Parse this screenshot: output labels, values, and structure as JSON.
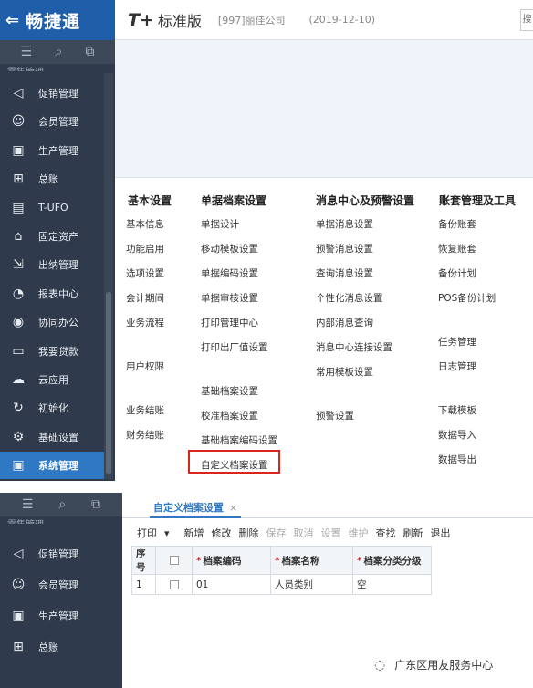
{
  "brand": {
    "back_icon": "back-arrow-icon",
    "name": "畅捷通"
  },
  "appbar": {
    "product": "T+",
    "edition": "标准版",
    "company": "[997]丽佳公司",
    "date": "(2019-12-10)",
    "search_stub": "搜"
  },
  "sidebar_top": {
    "toolbar_icons": [
      "menu-icon",
      "search-icon",
      "new-window-icon"
    ],
    "cut_label": "零售管理",
    "items": [
      {
        "label": "促销管理",
        "icon": "megaphone-icon",
        "glyph": "◁"
      },
      {
        "label": "会员管理",
        "icon": "member-icon",
        "glyph": "☺"
      },
      {
        "label": "生产管理",
        "icon": "production-icon",
        "glyph": "▣"
      },
      {
        "label": "总账",
        "icon": "ledger-icon",
        "glyph": "⊞"
      },
      {
        "label": "T-UFO",
        "icon": "ufo-icon",
        "glyph": "▤"
      },
      {
        "label": "固定资产",
        "icon": "bank-icon",
        "glyph": "⌂"
      },
      {
        "label": "出纳管理",
        "icon": "cashier-icon",
        "glyph": "⇲"
      },
      {
        "label": "报表中心",
        "icon": "report-icon",
        "glyph": "◔"
      },
      {
        "label": "协同办公",
        "icon": "collab-icon",
        "glyph": "◉"
      },
      {
        "label": "我要贷款",
        "icon": "loan-icon",
        "glyph": "▭"
      },
      {
        "label": "云应用",
        "icon": "cloud-icon",
        "glyph": "☁"
      },
      {
        "label": "初始化",
        "icon": "init-icon",
        "glyph": "↻"
      },
      {
        "label": "基础设置",
        "icon": "gear-icon",
        "glyph": "⚙"
      },
      {
        "label": "系统管理",
        "icon": "system-icon",
        "glyph": "▣"
      }
    ]
  },
  "menu": {
    "col1": {
      "header": "基本设置",
      "items": [
        "基本信息",
        "功能启用",
        "选项设置",
        "会计期间",
        "业务流程",
        "用户权限",
        "业务结账",
        "财务结账"
      ]
    },
    "col2": {
      "header": "单据档案设置",
      "items": [
        "单据设计",
        "移动模板设置",
        "单据编码设置",
        "单据审核设置",
        "打印管理中心",
        "打印出厂值设置",
        "基础档案设置",
        "校准档案设置",
        "基础档案编码设置",
        "自定义档案设置"
      ]
    },
    "col3": {
      "header": "消息中心及预警设置",
      "items": [
        "单据消息设置",
        "预警消息设置",
        "查询消息设置",
        "个性化消息设置",
        "内部消息查询",
        "消息中心连接设置",
        "常用模板设置",
        "预警设置"
      ]
    },
    "col4": {
      "header": "账套管理及工具",
      "items": [
        "备份账套",
        "恢复账套",
        "备份计划",
        "POS备份计划",
        "任务管理",
        "日志管理",
        "下载模板",
        "数据导入",
        "数据导出"
      ]
    }
  },
  "sidebar_bottom": {
    "toolbar_icons": [
      "menu-icon",
      "search-icon",
      "new-window-icon"
    ],
    "items": [
      {
        "label": "促销管理",
        "icon": "megaphone-icon",
        "glyph": "◁"
      },
      {
        "label": "会员管理",
        "icon": "member-icon",
        "glyph": "☺"
      },
      {
        "label": "生产管理",
        "icon": "production-icon",
        "glyph": "▣"
      },
      {
        "label": "总账",
        "icon": "ledger-icon",
        "glyph": "⊞"
      }
    ]
  },
  "doc_tab": {
    "label": "自定义档案设置",
    "close": "×"
  },
  "toolbar": {
    "print": "打印",
    "print_arrow": "▾",
    "new": "新增",
    "edit": "修改",
    "delete": "删除",
    "save": "保存",
    "cancel": "取消",
    "settings": "设置",
    "maintain": "维护",
    "find": "查找",
    "refresh": "刷新",
    "exit": "退出"
  },
  "table": {
    "headers": {
      "seq": "序号",
      "code": "档案编码",
      "name": "档案名称",
      "level": "档案分类分级"
    },
    "required_mark": "*",
    "rows": [
      {
        "seq": "1",
        "code": "01",
        "name": "人员类别",
        "level": "空"
      }
    ]
  },
  "watermark": {
    "text": "广东区用友服务中心"
  },
  "colors": {
    "brand_blue": "#1f5ea8",
    "sidebar_bg": "#2f3b4c",
    "active_item": "#2f78c4",
    "highlight_red": "#d9261c"
  }
}
